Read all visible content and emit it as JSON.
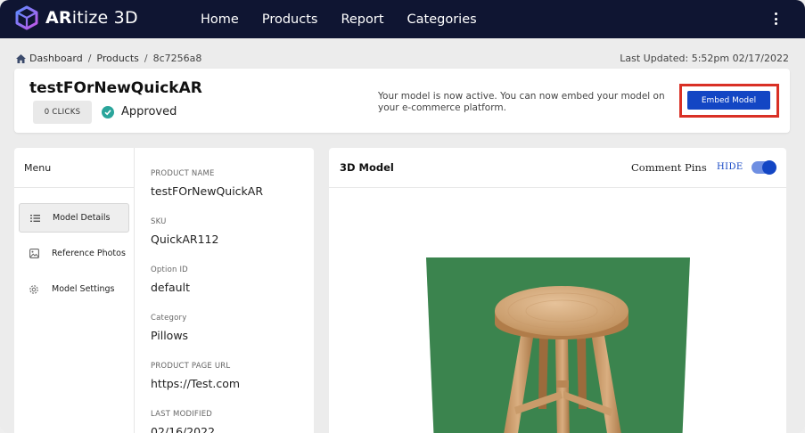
{
  "app": {
    "logo_bold": "AR",
    "logo_rest": "itize 3D"
  },
  "nav": {
    "links": [
      "Home",
      "Products",
      "Report",
      "Categories"
    ],
    "more_icon": "kebab-menu-icon"
  },
  "breadcrumb": {
    "items": [
      "Dashboard",
      "Products",
      "8c7256a8"
    ],
    "separator": "/"
  },
  "last_updated": "Last Updated: 5:52pm 02/17/2022",
  "product": {
    "title": "testFOrNewQuickAR",
    "clicks_label": "0 CLICKS",
    "status": "Approved",
    "status_color": "#2aa59b"
  },
  "activation": {
    "message": "Your model is now active. You can now embed your model on your e-commerce platform.",
    "embed_label": "Embed Model",
    "embed_color": "#1346c4",
    "highlight_color": "#d93025"
  },
  "menu": {
    "heading": "Menu",
    "items": [
      {
        "label": "Model Details",
        "icon": "list-icon",
        "active": true
      },
      {
        "label": "Reference Photos",
        "icon": "image-icon",
        "active": false
      },
      {
        "label": "Model Settings",
        "icon": "gear-icon",
        "active": false
      }
    ]
  },
  "details": {
    "product_name_label": "PRODUCT NAME",
    "product_name": "testFOrNewQuickAR",
    "sku_label": "SKU",
    "sku": "QuickAR112",
    "option_id_label": "Option ID",
    "option_id": "default",
    "category_label": "Category",
    "category": "Pillows",
    "url_label": "PRODUCT PAGE URL",
    "url": "https://Test.com",
    "modified_label": "LAST MODIFIED",
    "modified": "02/16/2022"
  },
  "model_panel": {
    "title": "3D Model",
    "pins_label": "Comment Pins",
    "hide_label": "HIDE",
    "toggle_on": true,
    "backdrop_color": "#3f8a52"
  }
}
